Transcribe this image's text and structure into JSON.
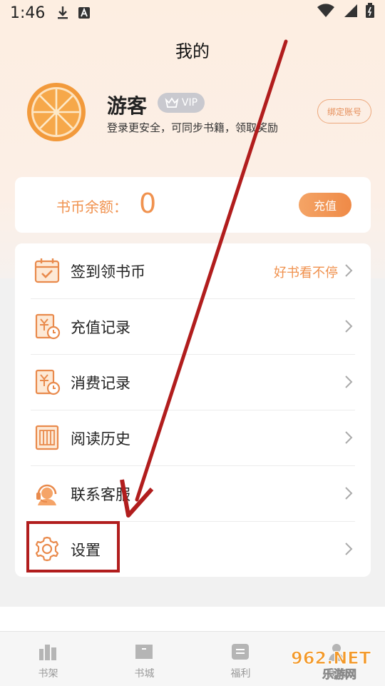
{
  "status": {
    "time": "1:46",
    "icons": [
      "download-icon",
      "a-letter-icon",
      "wifi-icon",
      "signal-icon",
      "battery-icon"
    ]
  },
  "header": {
    "title": "我的"
  },
  "profile": {
    "name": "游客",
    "vip_label": "VIP",
    "subtitle": "登录更安全，可同步书籍，领取奖励",
    "bind_label": "绑定账号"
  },
  "balance": {
    "label": "书币余额：",
    "value": "0",
    "recharge_label": "充值"
  },
  "menu": {
    "items": [
      {
        "label": "签到领书币",
        "hint": "好书看不停",
        "icon": "calendar-check-icon"
      },
      {
        "label": "充值记录",
        "hint": "",
        "icon": "yuan-clock-icon"
      },
      {
        "label": "消费记录",
        "hint": "",
        "icon": "yuan-clock-icon"
      },
      {
        "label": "阅读历史",
        "hint": "",
        "icon": "book-history-icon"
      },
      {
        "label": "联系客服",
        "hint": "",
        "icon": "customer-service-icon"
      },
      {
        "label": "设置",
        "hint": "",
        "icon": "gear-icon"
      }
    ]
  },
  "tabs": [
    {
      "label": "书架",
      "icon": "bookshelf-icon"
    },
    {
      "label": "书城",
      "icon": "bookstore-icon"
    },
    {
      "label": "福利",
      "icon": "welfare-icon"
    },
    {
      "label": "我的",
      "icon": "profile-icon"
    }
  ],
  "watermark": {
    "text_top": "962.NET",
    "text_bottom": "乐游网"
  },
  "colors": {
    "accent": "#f0924f",
    "annotation": "#b11d1d"
  }
}
